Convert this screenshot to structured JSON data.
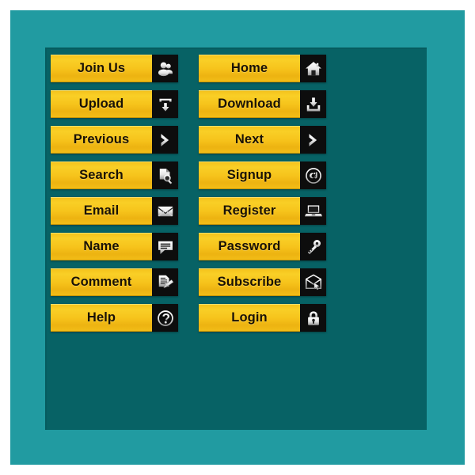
{
  "canvas": {
    "background": "#ffffff",
    "outer_frame_color": "#219ba1",
    "inner_panel_color": "#076265",
    "button_gradient_top": "#f9cf26",
    "button_gradient_bottom": "#edb311",
    "icon_box_color": "#0d0d0d",
    "label_text_color": "#1a1205"
  },
  "buttons": {
    "columns": [
      {
        "name": "left-column",
        "items": [
          {
            "label": "Join Us",
            "icon": "users-icon"
          },
          {
            "label": "Upload",
            "icon": "upload-icon"
          },
          {
            "label": "Previous",
            "icon": "arrow-right-icon"
          },
          {
            "label": "Search",
            "icon": "document-search-icon"
          },
          {
            "label": "Email",
            "icon": "envelope-icon"
          },
          {
            "label": "Name",
            "icon": "speech-bubble-icon"
          },
          {
            "label": "Comment",
            "icon": "document-pen-icon"
          },
          {
            "label": "Help",
            "icon": "question-mark-icon"
          }
        ]
      },
      {
        "name": "right-column",
        "items": [
          {
            "label": "Home",
            "icon": "house-icon"
          },
          {
            "label": "Download",
            "icon": "download-icon"
          },
          {
            "label": "Next",
            "icon": "arrow-right-icon"
          },
          {
            "label": "Signup",
            "icon": "at-sign-icon"
          },
          {
            "label": "Register",
            "icon": "laptop-icon"
          },
          {
            "label": "Password",
            "icon": "key-icon"
          },
          {
            "label": "Subscribe",
            "icon": "envelope-cursor-icon"
          },
          {
            "label": "Login",
            "icon": "padlock-icon"
          }
        ]
      }
    ]
  }
}
